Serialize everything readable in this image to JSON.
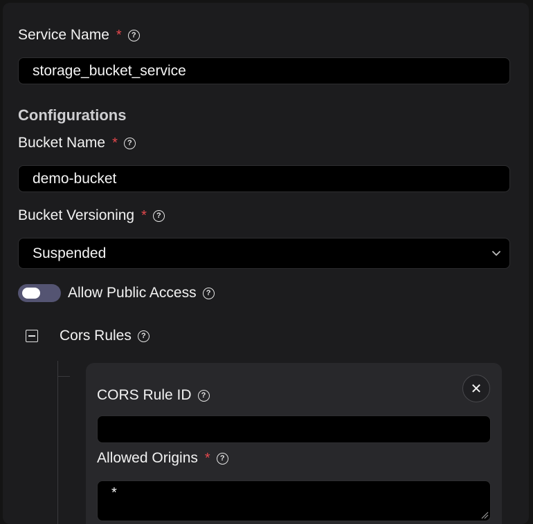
{
  "service_name": {
    "label": "Service Name",
    "required_mark": "*",
    "help": "?",
    "value": "storage_bucket_service"
  },
  "configurations": {
    "title": "Configurations",
    "bucket_name": {
      "label": "Bucket Name",
      "required_mark": "*",
      "help": "?",
      "value": "demo-bucket"
    },
    "bucket_versioning": {
      "label": "Bucket Versioning",
      "required_mark": "*",
      "help": "?",
      "selected": "Suspended"
    },
    "allow_public_access": {
      "label": "Allow Public Access",
      "help": "?",
      "enabled": false
    },
    "cors_rules": {
      "label": "Cors Rules",
      "help": "?",
      "rule": {
        "close": "✕",
        "rule_id": {
          "label": "CORS Rule ID",
          "help": "?",
          "value": ""
        },
        "allowed_origins": {
          "label": "Allowed Origins",
          "required_mark": "*",
          "help": "?",
          "value": "*"
        }
      }
    }
  },
  "colors": {
    "panel": "#1c1c1e",
    "input": "#000000",
    "required": "#e5484d",
    "toggle_track": "#545472",
    "card": "#28282b"
  }
}
